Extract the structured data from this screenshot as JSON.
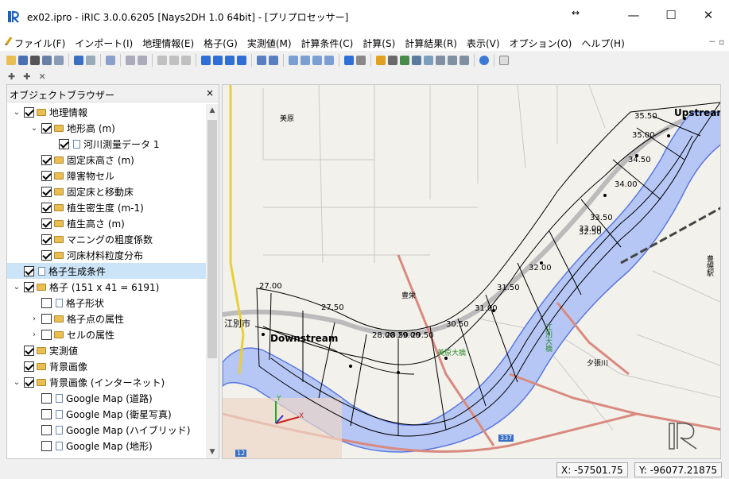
{
  "window": {
    "title": "ex02.ipro - iRIC 3.0.0.6205 [Nays2DH 1.0 64bit] - [プリプロセッサー]",
    "move_glyph": "↔",
    "minimize": "—",
    "maximize": "☐",
    "close": "✕"
  },
  "menu": {
    "items": [
      "ファイル(F)",
      "インポート(I)",
      "地理情報(E)",
      "格子(G)",
      "実測値(M)",
      "計算条件(C)",
      "計算(S)",
      "計算結果(R)",
      "表示(V)",
      "オプション(O)",
      "ヘルプ(H)"
    ],
    "mdi_controls": "－ ▫"
  },
  "toolbar2": {
    "icons": [
      "✚",
      "✚",
      "✕"
    ]
  },
  "browser": {
    "title": "オブジェクトブラウザー",
    "close": "×",
    "rows": [
      {
        "label": "地理情報",
        "indent": 0,
        "arrow": "down",
        "checked": true,
        "icon": "folder"
      },
      {
        "label": "地形高 (m)",
        "indent": 1,
        "arrow": "down",
        "checked": true,
        "icon": "folder"
      },
      {
        "label": "河川測量データ 1",
        "indent": 2,
        "arrow": "",
        "checked": true,
        "icon": "doc"
      },
      {
        "label": "固定床高さ (m)",
        "indent": 1,
        "arrow": "",
        "checked": true,
        "icon": "folder"
      },
      {
        "label": "障害物セル",
        "indent": 1,
        "arrow": "",
        "checked": true,
        "icon": "folder"
      },
      {
        "label": "固定床と移動床",
        "indent": 1,
        "arrow": "",
        "checked": true,
        "icon": "folder"
      },
      {
        "label": "植生密生度 (m-1)",
        "indent": 1,
        "arrow": "",
        "checked": true,
        "icon": "folder"
      },
      {
        "label": "植生高さ (m)",
        "indent": 1,
        "arrow": "",
        "checked": true,
        "icon": "folder"
      },
      {
        "label": "マニングの粗度係数",
        "indent": 1,
        "arrow": "",
        "checked": true,
        "icon": "folder"
      },
      {
        "label": "河床材料粒度分布",
        "indent": 1,
        "arrow": "",
        "checked": true,
        "icon": "folder"
      },
      {
        "label": "格子生成条件",
        "indent": 0,
        "arrow": "",
        "checked": true,
        "icon": "doc",
        "selected": true
      },
      {
        "label": "格子 (151 x 41 = 6191)",
        "indent": 0,
        "arrow": "down",
        "checked": true,
        "icon": "folder"
      },
      {
        "label": "格子形状",
        "indent": 1,
        "arrow": "",
        "checked": false,
        "icon": "doc"
      },
      {
        "label": "格子点の属性",
        "indent": 1,
        "arrow": "right",
        "checked": false,
        "icon": "folder"
      },
      {
        "label": "セルの属性",
        "indent": 1,
        "arrow": "right",
        "checked": false,
        "icon": "folder"
      },
      {
        "label": "実測値",
        "indent": 0,
        "arrow": "",
        "checked": true,
        "icon": "folder"
      },
      {
        "label": "背景画像",
        "indent": 0,
        "arrow": "",
        "checked": true,
        "icon": "folder"
      },
      {
        "label": "背景画像 (インターネット)",
        "indent": 0,
        "arrow": "down",
        "checked": true,
        "icon": "folder"
      },
      {
        "label": "Google Map (道路)",
        "indent": 1,
        "arrow": "",
        "checked": false,
        "icon": "doc"
      },
      {
        "label": "Google Map (衛星写真)",
        "indent": 1,
        "arrow": "",
        "checked": false,
        "icon": "doc"
      },
      {
        "label": "Google Map (ハイブリッド)",
        "indent": 1,
        "arrow": "",
        "checked": false,
        "icon": "doc"
      },
      {
        "label": "Google Map (地形)",
        "indent": 1,
        "arrow": "",
        "checked": false,
        "icon": "doc"
      }
    ]
  },
  "map": {
    "place_labels": [
      "美原",
      "豊栄",
      "江別市",
      "江別大橋",
      "美原大橋",
      "夕張川",
      "豊幌駅"
    ],
    "annotations": {
      "upstream": "Upstream",
      "downstream": "Downstream"
    },
    "station_labels": [
      "35.50",
      "35.00",
      "34.50",
      "34.00",
      "33.50",
      "33.00",
      "32.50",
      "32.00",
      "31.50",
      "31.00",
      "30.50",
      "29.50",
      "29.00",
      "28.50",
      "28.00",
      "27.50",
      "27.00"
    ],
    "axis_labels": {
      "y": "Y",
      "x": "X"
    },
    "route_badges": [
      "12",
      "337",
      "12"
    ],
    "logo": "iRIC"
  },
  "status": {
    "x": "X: -57501.75",
    "y": "Y: -96077.21875"
  },
  "colors": {
    "river": "#b6c7f5",
    "river_edge": "#5a78e0",
    "road_red": "#d98a80",
    "road_yellow": "#e8cf3a",
    "rail": "#444444",
    "selection": "#cce4f7"
  }
}
